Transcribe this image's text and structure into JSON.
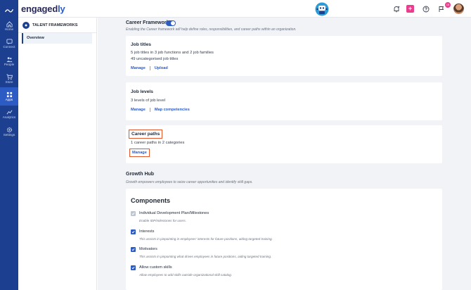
{
  "app": {
    "logo_text": "engaged",
    "logo_accent": "ly"
  },
  "rail": {
    "items": [
      {
        "label": "Home",
        "icon": "home-icon"
      },
      {
        "label": "Connect",
        "icon": "connect-icon"
      },
      {
        "label": "People",
        "icon": "people-icon"
      },
      {
        "label": "Store",
        "icon": "cart-icon"
      },
      {
        "label": "Apps",
        "icon": "apps-icon",
        "active": true
      },
      {
        "label": "Analytics",
        "icon": "analytics-icon"
      },
      {
        "label": "Settings",
        "icon": "gear-icon"
      }
    ]
  },
  "topbar": {
    "plus_label": "+",
    "notification_count": "15"
  },
  "subnav": {
    "title": "TALENT FRAMEWORKS",
    "items": [
      {
        "label": "Overview"
      }
    ]
  },
  "career_framework": {
    "title": "Career Framework",
    "toggle_on": true,
    "description": "Enabling the Career framework will help define roles, responsibilities, and career paths within an organization."
  },
  "job_titles": {
    "title": "Job titles",
    "line1": "5 job titles in 3 job functions and 2 job families",
    "line2": "49 uncategorised job titles",
    "links": [
      "Manage",
      "Upload"
    ]
  },
  "job_levels": {
    "title": "Job levels",
    "line1": "3 levels of job level",
    "links": [
      "Manage",
      "Map competencies"
    ]
  },
  "career_paths": {
    "title": "Career paths",
    "line1": "1 career paths in 2 categories",
    "links": [
      "Manage"
    ]
  },
  "growth_hub": {
    "title": "Growth Hub",
    "description": "Growth empowers employees to seize career opportunities and identify skill gaps."
  },
  "components": {
    "title": "Components",
    "items": [
      {
        "label": "Individual Development Plan/Milestones",
        "desc": "Enable IDP/milestones for users.",
        "checked": true,
        "disabled": true
      },
      {
        "label": "Interests",
        "desc": "This assists in pinpointing in employees' interests for future positions, aiding targeted training.",
        "checked": true
      },
      {
        "label": "Motivators",
        "desc": "This assists in pinpointing what drives employees in future positions, aiding targeted training.",
        "checked": true
      },
      {
        "label": "Allow custom skills",
        "desc": "Allow employees to add skills outside organizational skill catalog.",
        "checked": true
      }
    ]
  },
  "colors": {
    "rail": "#1d3f8f",
    "accent": "#2d5bc4",
    "highlight": "#e2582c",
    "pink": "#e83e8c"
  }
}
